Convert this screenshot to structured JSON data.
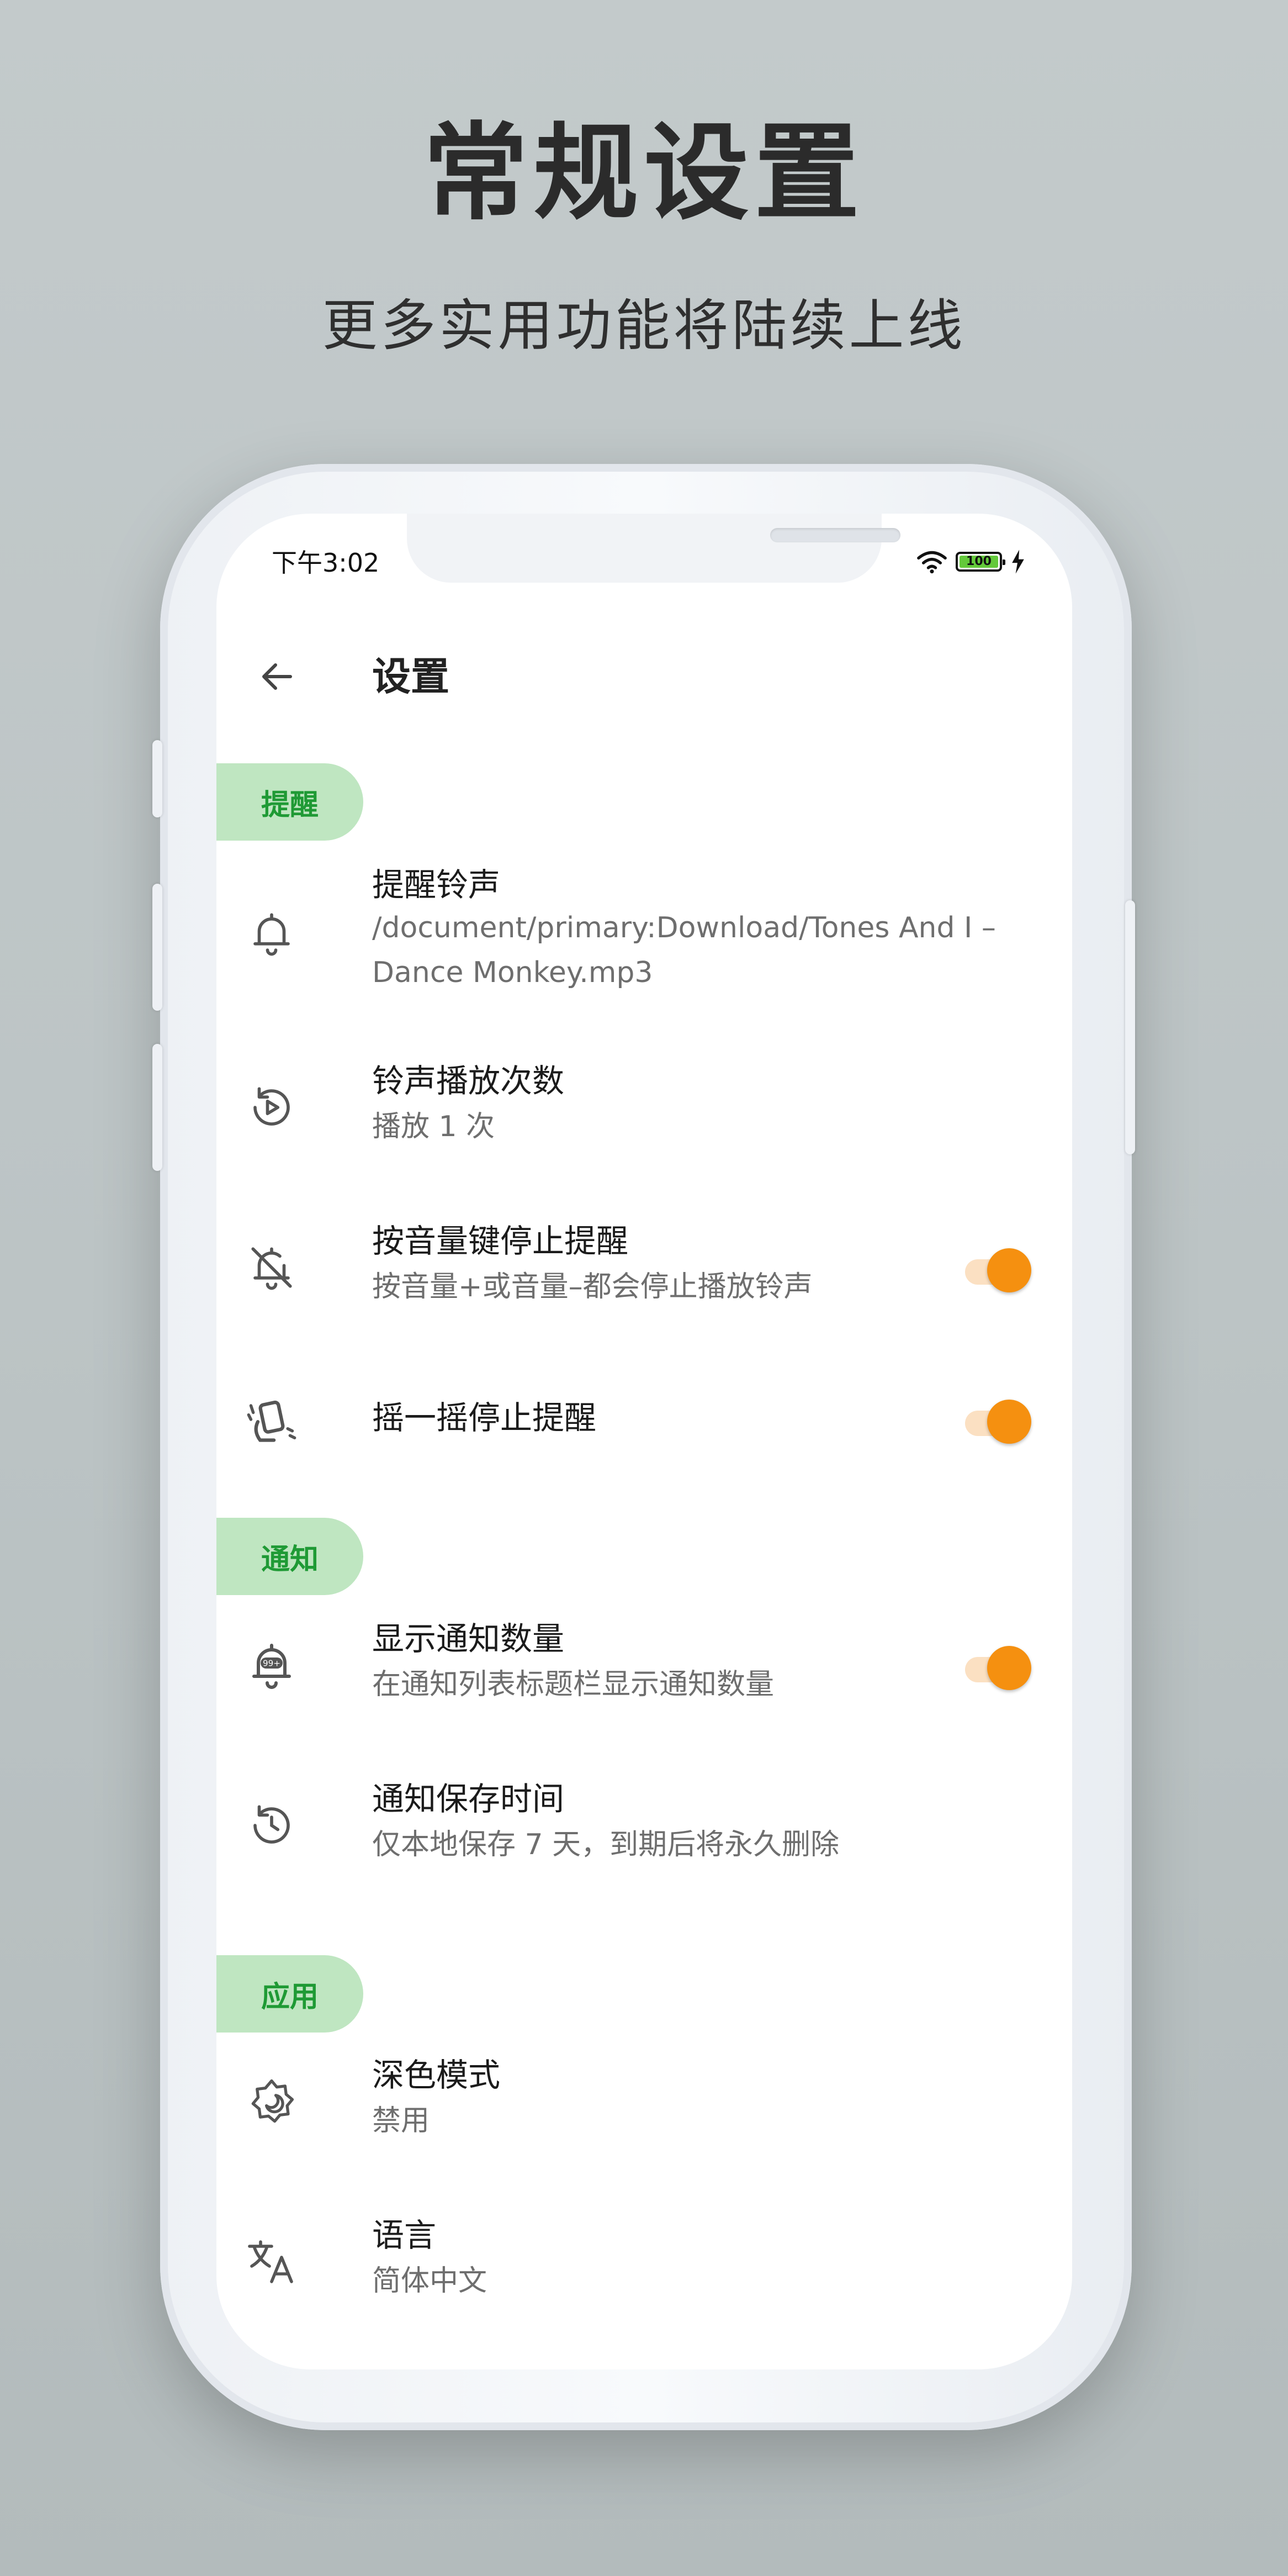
{
  "hero": {
    "title": "常规设置",
    "subtitle": "更多实用功能将陆续上线"
  },
  "status_bar": {
    "time": "下午3:02",
    "battery": "100",
    "icons": [
      "wifi-icon",
      "battery-icon",
      "charging-bolt-icon"
    ]
  },
  "appbar": {
    "title": "设置",
    "back_icon": "arrow-left-icon"
  },
  "sections": {
    "reminder": {
      "label": "提醒",
      "items": {
        "ringtone": {
          "title": "提醒铃声",
          "subtitle": "/document/primary:Download/Tones And I – Dance Monkey.mp3",
          "icon": "bell-icon"
        },
        "play_count": {
          "title": "铃声播放次数",
          "subtitle": "播放 1 次",
          "icon": "replay-icon"
        },
        "volume_stop": {
          "title": "按音量键停止提醒",
          "subtitle": "按音量+或音量–都会停止播放铃声",
          "icon": "bell-off-icon",
          "toggle_on": true
        },
        "shake_stop": {
          "title": "摇一摇停止提醒",
          "icon": "shake-phone-icon",
          "toggle_on": true
        }
      }
    },
    "notification": {
      "label": "通知",
      "items": {
        "show_count": {
          "title": "显示通知数量",
          "subtitle": "在通知列表标题栏显示通知数量",
          "icon": "notification-badge-icon",
          "badge": "99+",
          "toggle_on": true
        },
        "retention": {
          "title": "通知保存时间",
          "subtitle": "仅本地保存 7 天，到期后将永久删除",
          "icon": "history-icon"
        }
      }
    },
    "app": {
      "label": "应用",
      "items": {
        "dark_mode": {
          "title": "深色模式",
          "subtitle": "禁用",
          "icon": "dark-mode-icon"
        },
        "language": {
          "title": "语言",
          "subtitle": "简体中文",
          "icon": "translate-icon"
        }
      }
    }
  },
  "colors": {
    "accent_orange": "#f59010",
    "section_pill_bg": "#bfe6c1",
    "section_pill_text": "#1f9a35",
    "battery_green": "#63c93a"
  }
}
